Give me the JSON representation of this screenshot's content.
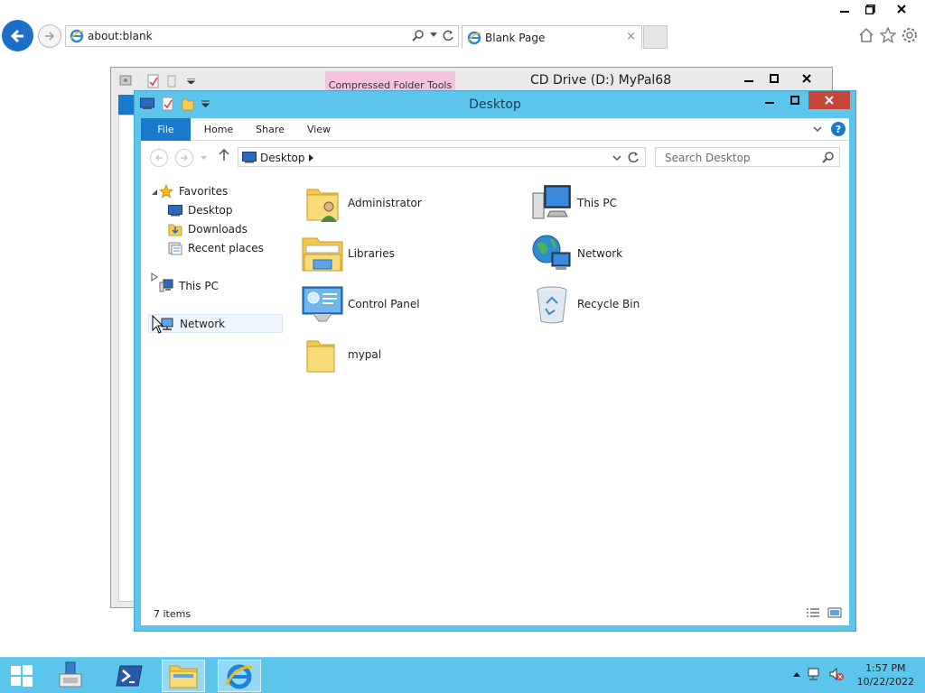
{
  "browser": {
    "address": "about:blank",
    "tab_label": "Blank Page",
    "tab_close": "×"
  },
  "back_window": {
    "title": "CD Drive (D:) MyPal68",
    "contextual_tab": "Compressed Folder Tools"
  },
  "explorer": {
    "title": "Desktop",
    "ribbon_tabs": {
      "file": "File",
      "home": "Home",
      "share": "Share",
      "view": "View"
    },
    "help": "?",
    "breadcrumb": "Desktop",
    "search_placeholder": "Search Desktop",
    "nav": {
      "favorites": "Favorites",
      "desktop": "Desktop",
      "downloads": "Downloads",
      "recent": "Recent places",
      "this_pc": "This PC",
      "network": "Network"
    },
    "items": [
      {
        "label": "Administrator",
        "icon": "user-folder-icon"
      },
      {
        "label": "This PC",
        "icon": "computer-icon"
      },
      {
        "label": "Libraries",
        "icon": "libraries-icon"
      },
      {
        "label": "Network",
        "icon": "network-icon"
      },
      {
        "label": "Control Panel",
        "icon": "control-panel-icon"
      },
      {
        "label": "Recycle Bin",
        "icon": "recycle-bin-icon"
      },
      {
        "label": "mypal",
        "icon": "folder-icon"
      }
    ],
    "status": "7 items"
  },
  "taskbar": {
    "time": "1:57 PM",
    "date": "10/22/2022"
  },
  "colors": {
    "accent": "#1979ca",
    "window_frame": "#5cc5ec",
    "close_red": "#c7463a",
    "contextual_pink": "#f7c2e0"
  }
}
